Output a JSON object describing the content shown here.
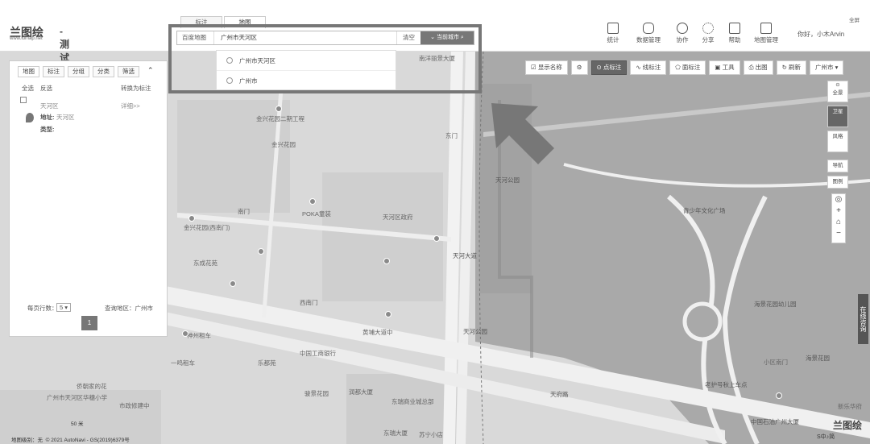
{
  "app": {
    "brand": "兰图绘",
    "domain": "www.ldmap.net",
    "title": "- 测试地图",
    "fullscreen": "全屏",
    "greeting": "你好，小木Arvin"
  },
  "nav": [
    {
      "label": "统计",
      "icon": "bar-chart-icon"
    },
    {
      "label": "数据管理",
      "icon": "database-icon"
    },
    {
      "label": "协作",
      "icon": "users-icon"
    },
    {
      "label": "分享",
      "icon": "share-icon"
    },
    {
      "label": "帮助",
      "icon": "book-icon"
    },
    {
      "label": "地图管理",
      "icon": "exit-icon"
    }
  ],
  "search": {
    "tabs": [
      "标注",
      "地图"
    ],
    "active_tab": "地图",
    "source": "百度地图",
    "value": "广州市天河区",
    "clear": "清空",
    "city_button": "当前城市",
    "suggestions": [
      "广州市天河区",
      "广州市"
    ]
  },
  "toolbar": {
    "show_name": "显示名称",
    "point": "点标注",
    "line": "线标注",
    "area": "面标注",
    "tools": "工具",
    "print": "出图",
    "refresh": "刷新",
    "city": "广州市"
  },
  "panel": {
    "tabs": [
      "地图",
      "标注",
      "分组",
      "分类",
      "筛选"
    ],
    "select_all": "全选",
    "invert": "反选",
    "convert": "转换为标注",
    "item_name": "天河区",
    "details": "详细>>",
    "address_label": "地址:",
    "address_value": "天河区",
    "type_label": "类型:",
    "rows_per_page": "每页行数：",
    "rows_value": "5",
    "query_area": "查询地区：广州市",
    "page": "1"
  },
  "controls": {
    "fullview": "全景",
    "satellite": "卫星",
    "style": "风格",
    "guide": "导航",
    "legend": "图例"
  },
  "map_labels": [
    "南洋丽景大厦",
    "金兴花园二期工程",
    "金兴花园",
    "天河区政府",
    "POKA童装",
    "东成花苑",
    "天河公园",
    "青少年文化广场",
    "海景花园幼儿园",
    "海景花园",
    "金兴花园(西南门)",
    "南门",
    "东门",
    "西南门",
    "天河公园",
    "神州租车",
    "一鸣租车",
    "中国工商银行",
    "乐都苑",
    "黄埔大道中",
    "骏景花园",
    "润都大厦",
    "东瑞商业城总部",
    "东瑞大厦",
    "苏宁小店",
    "广州市天河区华穗小学",
    "侨朝家的花",
    "市政修建中",
    "老护号秋上车点",
    "中国石油广州大厦",
    "新乐华府",
    "小区南门",
    "天府路",
    "天河大道",
    "东门"
  ],
  "footer": {
    "scale": "50 米",
    "copyright": "© 2021 AutoNavi - GS(2019)6379号",
    "level": "地图级别：无"
  },
  "side_service": "在线咨询",
  "bottom_bar": "S中♪简"
}
